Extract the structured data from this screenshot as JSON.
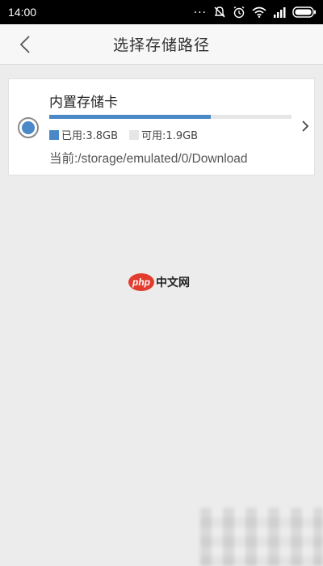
{
  "status_bar": {
    "time": "14:00",
    "dots": "..."
  },
  "header": {
    "title": "选择存储路径"
  },
  "storage": {
    "name": "内置存储卡",
    "used_label": "已用:3.8GB",
    "free_label": "可用:1.9GB",
    "used_fraction": 0.667,
    "path_label": "当前:/storage/emulated/0/Download",
    "selected": true
  },
  "watermark": {
    "logo_text": "php",
    "text": "中文网"
  },
  "colors": {
    "accent": "#4a88c7",
    "free": "#e6e6e6",
    "background": "#ececec",
    "watermark_red": "#e23c2e"
  },
  "icons": {
    "back": "chevron-left-icon",
    "next": "chevron-right-icon",
    "status": [
      "mute-icon",
      "alarm-icon",
      "wifi-icon",
      "signal-icon",
      "battery-icon"
    ]
  }
}
